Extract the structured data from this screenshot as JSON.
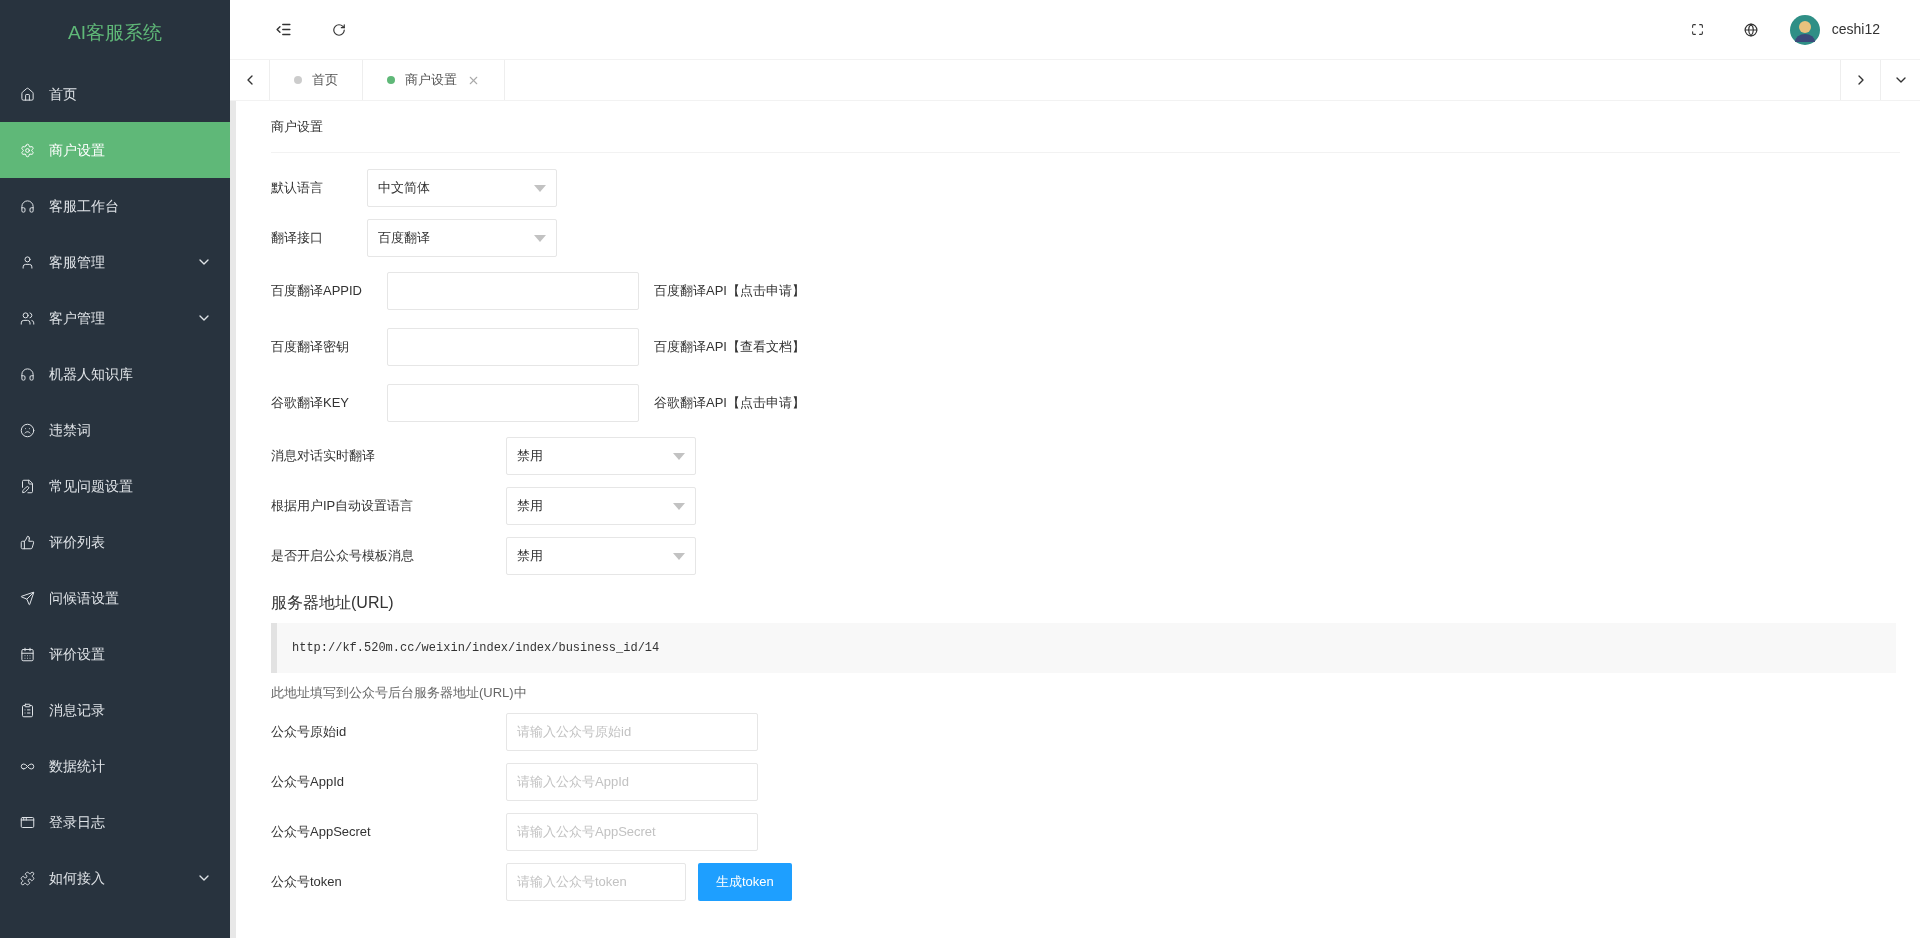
{
  "sidebar": {
    "logo": "AI客服系统",
    "items": [
      {
        "label": "首页",
        "selected": false,
        "expandable": false
      },
      {
        "label": "商户设置",
        "selected": true,
        "expandable": false
      },
      {
        "label": "客服工作台",
        "selected": false,
        "expandable": false
      },
      {
        "label": "客服管理",
        "selected": false,
        "expandable": true
      },
      {
        "label": "客户管理",
        "selected": false,
        "expandable": true
      },
      {
        "label": "机器人知识库",
        "selected": false,
        "expandable": false
      },
      {
        "label": "违禁词",
        "selected": false,
        "expandable": false
      },
      {
        "label": "常见问题设置",
        "selected": false,
        "expandable": false
      },
      {
        "label": "评价列表",
        "selected": false,
        "expandable": false
      },
      {
        "label": "问候语设置",
        "selected": false,
        "expandable": false
      },
      {
        "label": "评价设置",
        "selected": false,
        "expandable": false
      },
      {
        "label": "消息记录",
        "selected": false,
        "expandable": false
      },
      {
        "label": "数据统计",
        "selected": false,
        "expandable": false
      },
      {
        "label": "登录日志",
        "selected": false,
        "expandable": false
      },
      {
        "label": "如何接入",
        "selected": false,
        "expandable": true
      }
    ]
  },
  "header": {
    "username": "ceshi12"
  },
  "tabs": [
    {
      "label": "首页",
      "selected": false
    },
    {
      "label": "商户设置",
      "selected": true
    }
  ],
  "card_title": "商户设置",
  "form": [
    {
      "kind": "select",
      "label": "默认语言",
      "value": "中文简体"
    },
    {
      "kind": "select",
      "label": "翻译接口",
      "value": "百度翻译"
    },
    {
      "kind": "input",
      "label": "百度翻译APPID",
      "link": "百度翻译API【点击申请】"
    },
    {
      "kind": "input",
      "label": "百度翻译密钥",
      "link": "百度翻译API【查看文档】"
    },
    {
      "kind": "input",
      "label": "谷歌翻译KEY",
      "link": "谷歌翻译API【点击申请】"
    },
    {
      "kind": "switch",
      "label": "消息对话实时翻译",
      "value": "禁用"
    },
    {
      "kind": "switch",
      "label": "根据用户IP自动设置语言",
      "value": "禁用"
    },
    {
      "kind": "switch",
      "label": "是否开启公众号模板消息",
      "value": "禁用"
    }
  ],
  "server": {
    "heading": "服务器地址(URL)",
    "url": "http://kf.520m.cc/weixin/index/index/business_id/14",
    "hint": "此地址填写到公众号后台服务器地址(URL)中"
  },
  "wechat": [
    {
      "label": "公众号原始id",
      "placeholder": "请输入公众号原始id"
    },
    {
      "label": "公众号AppId",
      "placeholder": "请输入公众号AppId"
    },
    {
      "label": "公众号AppSecret",
      "placeholder": "请输入公众号AppSecret"
    },
    {
      "label": "公众号token",
      "placeholder": "请输入公众号token",
      "button": "生成token"
    }
  ]
}
